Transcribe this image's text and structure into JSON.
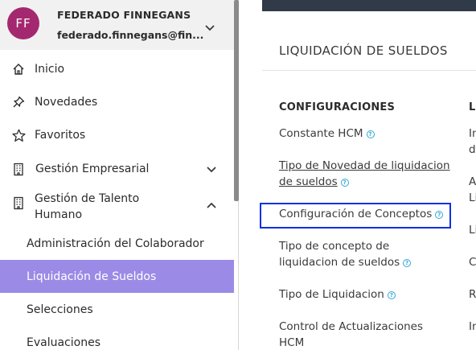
{
  "user": {
    "initials": "FF",
    "name": "FEDERADO FINNEGANS",
    "email": "federado.finnegans@fin..."
  },
  "nav": {
    "inicio": "Inicio",
    "novedades": "Novedades",
    "favoritos": "Favoritos",
    "gestion_empresarial": "Gestión Empresarial",
    "gestion_talento_line1": "Gestión de Talento",
    "gestion_talento_line2": "Humano",
    "sub": {
      "administracion": "Administración del Colaborador",
      "liquidacion": "Liquidación de Sueldos",
      "selecciones": "Selecciones",
      "evaluaciones": "Evaluaciones"
    }
  },
  "main": {
    "title": "LIQUIDACIÓN DE SUELDOS",
    "col1_head": "CONFIGURACIONES",
    "col2_head": "L",
    "links": {
      "constante": "Constante HCM",
      "tipo_novedad_1": "Tipo de Novedad de liquidacion",
      "tipo_novedad_2": "de sueldos",
      "config_conceptos": "Configuración de Conceptos",
      "tipo_concepto_1": "Tipo de concepto de",
      "tipo_concepto_2": "liquidacion de sueldos",
      "tipo_liquidacion": "Tipo de Liquidacion",
      "control_1": "Control de Actualizaciones",
      "control_2": "HCM"
    },
    "right_col": {
      "r1a": "In",
      "r1b": "d",
      "r2a": "A",
      "r2b": "Li",
      "r3": "Li",
      "r4": "C",
      "r5": "R",
      "r6": "In"
    },
    "help_glyph": "?"
  },
  "colors": {
    "avatar": "#a4286f",
    "active_item": "#9b8be6",
    "highlight_border": "#1030e0",
    "topbar": "#313a48",
    "help_icon": "#2ea8d8"
  }
}
